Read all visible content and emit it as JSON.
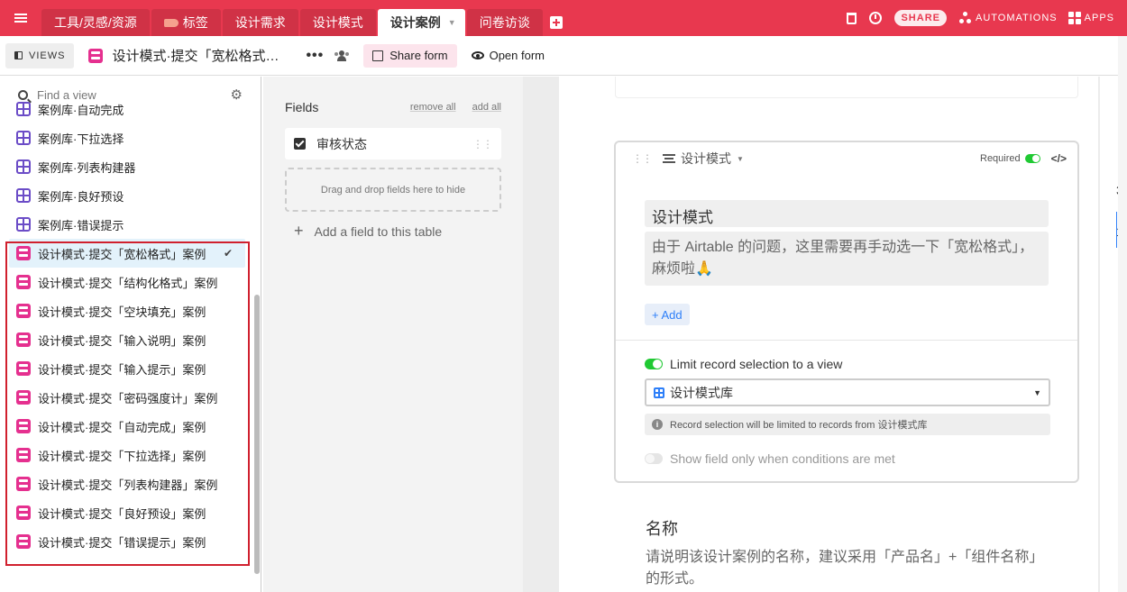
{
  "topbar": {
    "tabs": [
      {
        "label": "工具/灵感/资源"
      },
      {
        "label": "标签"
      },
      {
        "label": "设计需求"
      },
      {
        "label": "设计模式"
      },
      {
        "label": "设计案例",
        "active": true
      },
      {
        "label": "问卷访谈"
      }
    ],
    "share_label": "SHARE",
    "automations_label": "AUTOMATIONS",
    "apps_label": "APPS",
    "accent_color": "#e8384f"
  },
  "viewbar": {
    "views_label": "VIEWS",
    "view_title": "设计模式·提交「宽松格式…",
    "more_label": "•••",
    "share_form_label": "Share form",
    "open_form_label": "Open form"
  },
  "sidebar": {
    "search_placeholder": "Find a view",
    "items": [
      {
        "label": "案例库·自动完成",
        "type": "grid"
      },
      {
        "label": "案例库·下拉选择",
        "type": "grid"
      },
      {
        "label": "案例库·列表构建器",
        "type": "grid"
      },
      {
        "label": "案例库·良好预设",
        "type": "grid"
      },
      {
        "label": "案例库·错误提示",
        "type": "grid"
      },
      {
        "label": "设计模式·提交「宽松格式」案例",
        "type": "form",
        "selected": true
      },
      {
        "label": "设计模式·提交「结构化格式」案例",
        "type": "form"
      },
      {
        "label": "设计模式·提交「空块填充」案例",
        "type": "form"
      },
      {
        "label": "设计模式·提交「输入说明」案例",
        "type": "form"
      },
      {
        "label": "设计模式·提交「输入提示」案例",
        "type": "form"
      },
      {
        "label": "设计模式·提交「密码强度计」案例",
        "type": "form"
      },
      {
        "label": "设计模式·提交「自动完成」案例",
        "type": "form"
      },
      {
        "label": "设计模式·提交「下拉选择」案例",
        "type": "form"
      },
      {
        "label": "设计模式·提交「列表构建器」案例",
        "type": "form"
      },
      {
        "label": "设计模式·提交「良好预设」案例",
        "type": "form"
      },
      {
        "label": "设计模式·提交「错误提示」案例",
        "type": "form"
      }
    ],
    "check_mark": "✔"
  },
  "fields": {
    "title": "Fields",
    "remove_all": "remove all",
    "add_all": "add all",
    "hidden_field": "审核状态",
    "drop_zone": "Drag and drop fields here to hide",
    "add_field": "Add a field to this table"
  },
  "form": {
    "field_type": "设计模式",
    "required_label": "Required",
    "label_value": "设计模式",
    "description_value": "由于 Airtable 的问题，这里需要再手动选一下「宽松格式」，麻烦啦🙏",
    "add_label": "+ Add",
    "limit_label": "Limit record selection to a view",
    "selected_view": "设计模式库",
    "info_text": "Record selection will be limited to records from 设计模式库",
    "condition_label": "Show field only when conditions are met",
    "next_field_label": "名称",
    "next_field_desc": "请说明该设计案例的名称，建议采用「产品名」+「组件名称」的形式。"
  },
  "edge": {
    "num_a": "38",
    "num_b": "15"
  }
}
